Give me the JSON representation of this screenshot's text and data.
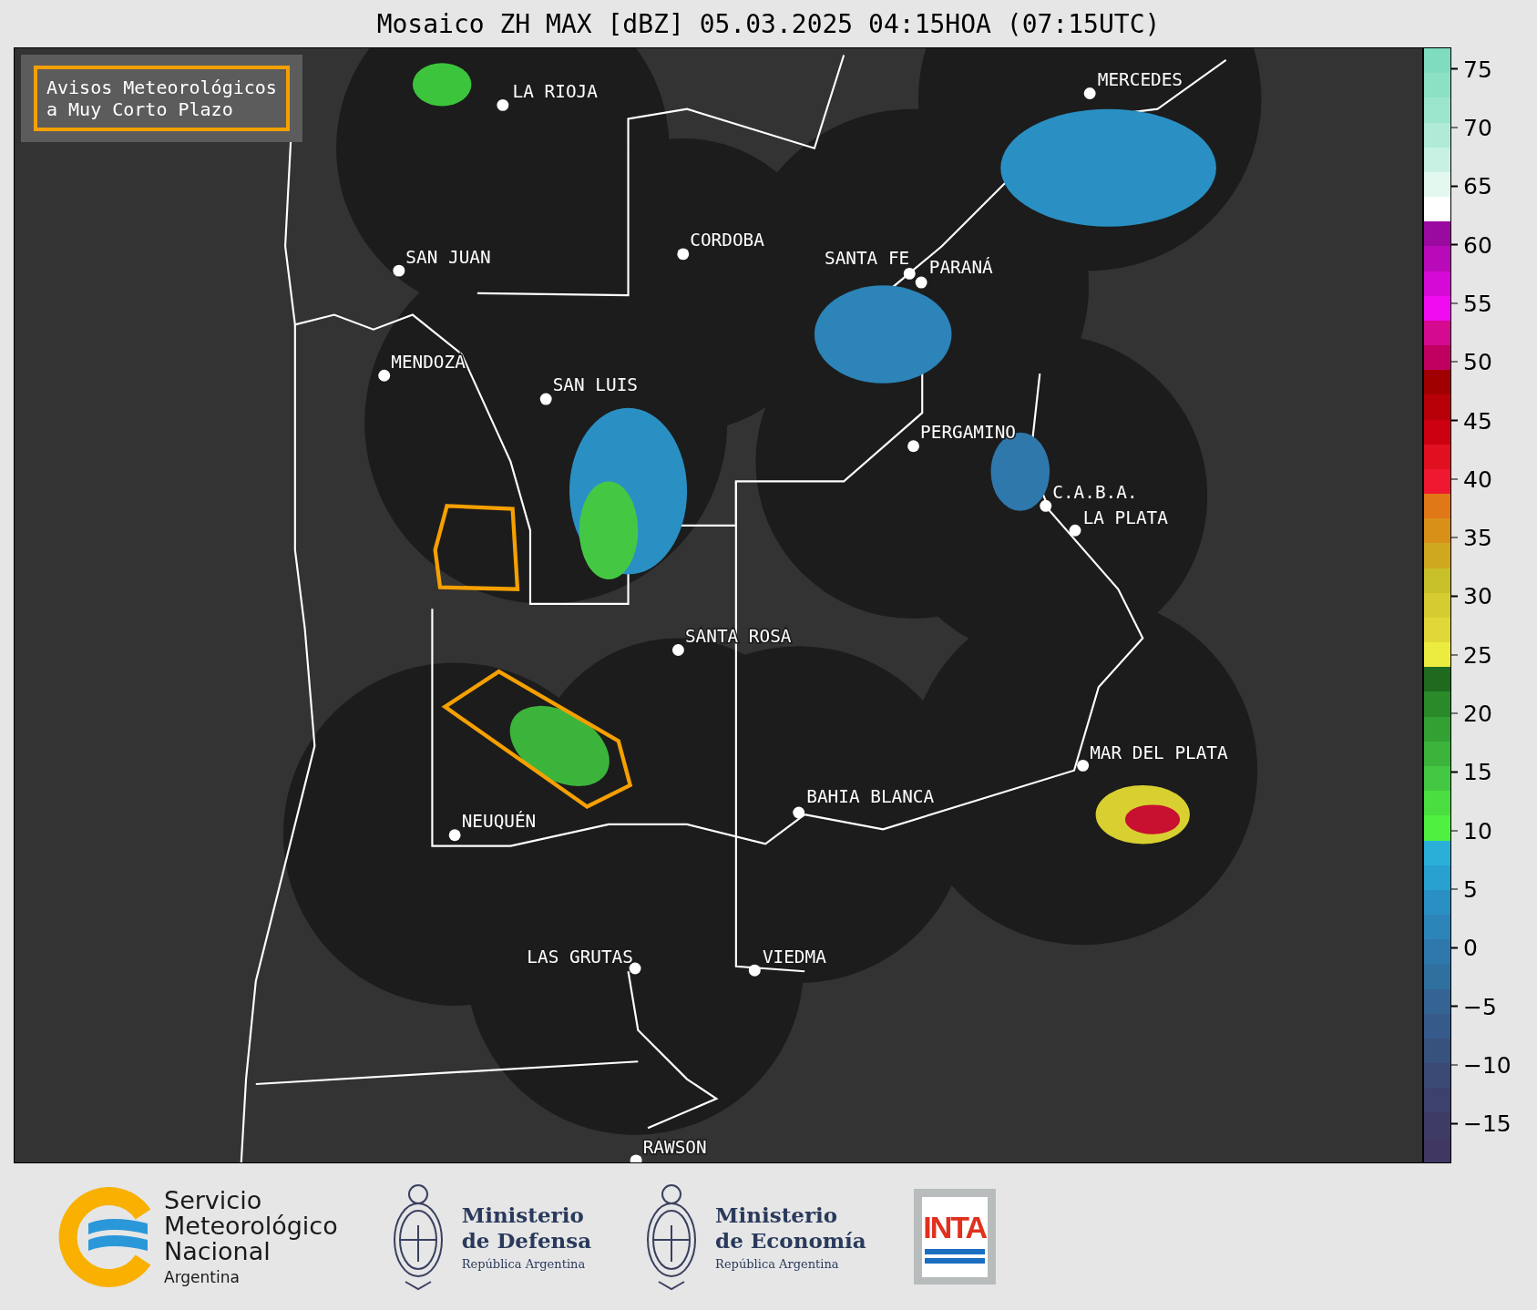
{
  "title": "Mosaico ZH MAX [dBZ] 05.03.2025 04:15HOA (07:15UTC)",
  "legend": {
    "lines": [
      "Avisos Meteorológicos",
      "a Muy Corto Plazo"
    ]
  },
  "cities": [
    {
      "name": "LA RIOJA"
    },
    {
      "name": "SAN JUAN"
    },
    {
      "name": "CORDOBA"
    },
    {
      "name": "SANTA FE"
    },
    {
      "name": "PARANÁ"
    },
    {
      "name": "MERCEDES"
    },
    {
      "name": "MENDOZA"
    },
    {
      "name": "SAN LUIS"
    },
    {
      "name": "PERGAMINO"
    },
    {
      "name": "C.A.B.A."
    },
    {
      "name": "LA PLATA"
    },
    {
      "name": "SANTA ROSA"
    },
    {
      "name": "MAR DEL PLATA"
    },
    {
      "name": "BAHIA BLANCA"
    },
    {
      "name": "NEUQUÉN"
    },
    {
      "name": "LAS GRUTAS"
    },
    {
      "name": "VIEDMA"
    },
    {
      "name": "RAWSON"
    }
  ],
  "colorbar": {
    "ticks": [
      "75",
      "70",
      "65",
      "60",
      "55",
      "50",
      "45",
      "40",
      "35",
      "30",
      "25",
      "20",
      "15",
      "10",
      "5",
      "0",
      "−5",
      "−10",
      "−15"
    ]
  },
  "footer": {
    "smn": {
      "lines": [
        "Servicio",
        "Meteorológico",
        "Nacional"
      ],
      "country": "Argentina"
    },
    "ministries": [
      {
        "lines": [
          "Ministerio",
          "de Defensa"
        ],
        "country": "República Argentina"
      },
      {
        "lines": [
          "Ministerio",
          "de Economía"
        ],
        "country": "República Argentina"
      }
    ],
    "inta": {
      "text": "INTA"
    }
  }
}
